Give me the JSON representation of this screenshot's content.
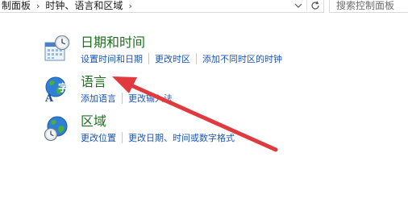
{
  "address_bar": {
    "crumbs": [
      "制面板",
      "时钟、语言和区域"
    ],
    "separator": "›"
  },
  "search": {
    "placeholder": "搜索控制面板"
  },
  "categories": [
    {
      "title": "日期和时间",
      "icon": "calendar-clock-icon",
      "links": [
        "设置时间和日期",
        "更改时区",
        "添加不同时区的时钟"
      ]
    },
    {
      "title": "语言",
      "icon": "language-globe-icon",
      "links": [
        "添加语言",
        "更改输入法"
      ]
    },
    {
      "title": "区域",
      "icon": "region-globe-clock-icon",
      "links": [
        "更改位置",
        "更改日期、时间或数字格式"
      ]
    }
  ],
  "colors": {
    "title_green": "#1e6f1e",
    "link_blue": "#1a56b3",
    "annotation_red": "#e0393e"
  }
}
